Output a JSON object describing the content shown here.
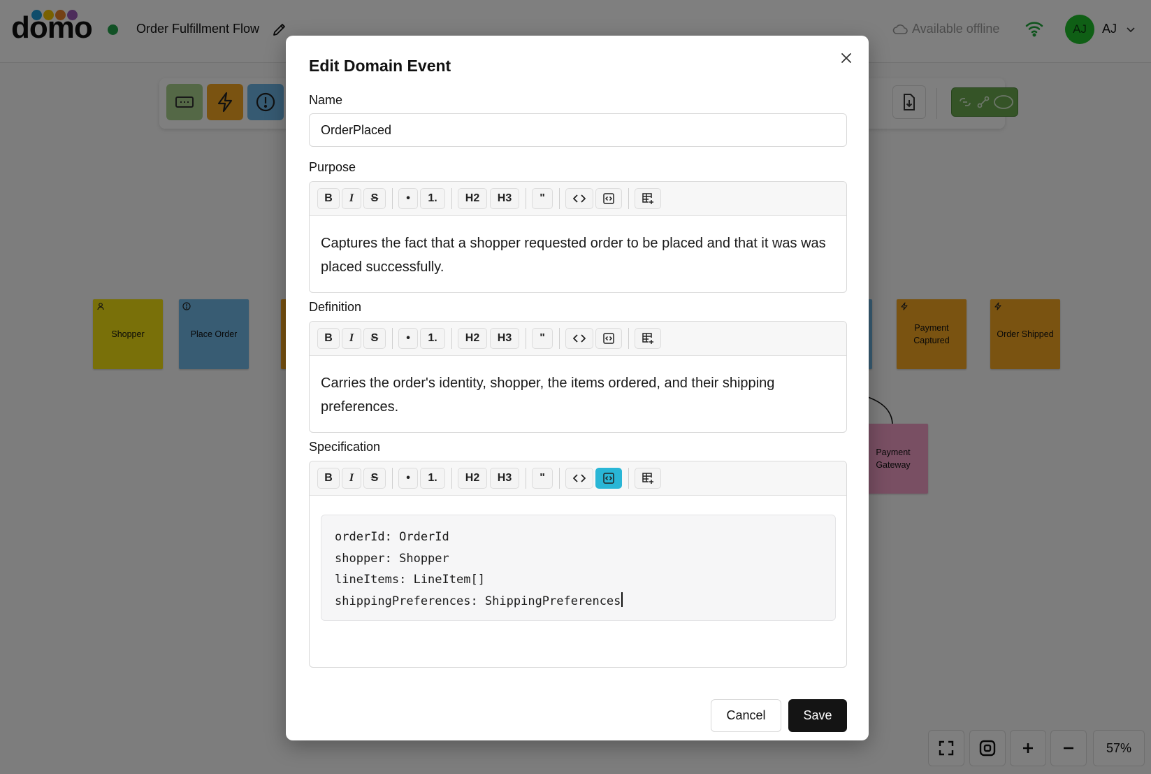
{
  "app": {
    "logo_text": "domo",
    "logo_dot_colors": [
      "#1e9bd7",
      "#f2c300",
      "#e8822a",
      "#9b59b6"
    ],
    "document_title": "Order Fulfillment Flow",
    "sync_status_color": "#22a34a",
    "offline_label": "Available offline",
    "user": {
      "initials": "AJ",
      "name": "AJ",
      "avatar_color": "#1fbf2a"
    }
  },
  "palette": {
    "items": [
      {
        "icon": "command-icon",
        "color": "#a8d08d"
      },
      {
        "icon": "lightning-icon",
        "color": "#f5a623"
      },
      {
        "icon": "alert-icon",
        "color": "#6cb4e4"
      },
      {
        "icon": "export-icon",
        "color": "#ffffff"
      },
      {
        "icon": "connector-tools-icon",
        "color": "#6aa84f"
      }
    ]
  },
  "canvas": {
    "stickies": [
      {
        "label": "Shopper",
        "color": "#f2e013",
        "icon": "person-icon"
      },
      {
        "label": "Place Order",
        "color": "#70b8e6",
        "icon": "alert-icon"
      },
      {
        "label": "Payment Captured",
        "color": "#f5a623",
        "icon": "lightning-icon"
      },
      {
        "label": "Order Shipped",
        "color": "#f5a623",
        "icon": "lightning-icon"
      },
      {
        "label": "Payment Gateway",
        "color": "#f29fc6",
        "icon": ""
      }
    ],
    "zoom_level": "57%"
  },
  "modal": {
    "title": "Edit Domain Event",
    "name": {
      "label": "Name",
      "value": "OrderPlaced"
    },
    "purpose": {
      "label": "Purpose",
      "text": "Captures the fact that a shopper requested order to be placed and that it was was placed successfully."
    },
    "definition": {
      "label": "Definition",
      "text": "Carries the order's identity, shopper, the items ordered, and their shipping preferences."
    },
    "specification": {
      "label": "Specification",
      "code_lines": [
        "orderId: OrderId",
        "shopper: Shopper",
        "lineItems: LineItem[]",
        "shippingPreferences: ShippingPreferences"
      ]
    },
    "toolbar": {
      "bold": "B",
      "italic": "I",
      "strike": "S",
      "bullet": "•",
      "ordered": "1.",
      "h2": "H2",
      "h3": "H3",
      "quote": "\"",
      "active_color": "#29b6d6"
    },
    "cancel_label": "Cancel",
    "save_label": "Save"
  }
}
